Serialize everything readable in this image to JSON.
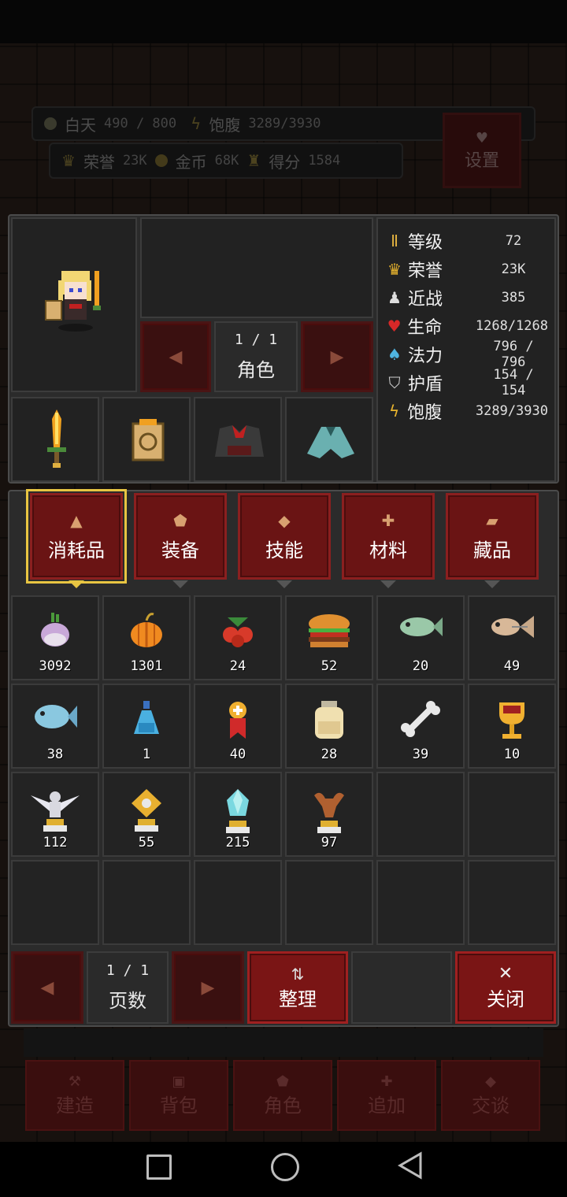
{
  "hud": {
    "day_label": "白天",
    "day_value": "490 / 800",
    "hunger_label": "饱腹",
    "hunger_value": "3289/3930",
    "honor_label": "荣誉",
    "honor_value": "23K",
    "gold_label": "金币",
    "gold_value": "68K",
    "score_label": "得分",
    "score_value": "1584",
    "settings_label": "设置"
  },
  "character": {
    "page": "1  /  1",
    "label": "角色"
  },
  "stats": [
    {
      "icon": "level-icon",
      "glyph": "Ⅱ",
      "color": "#e0b040",
      "label": "等级",
      "value": "72"
    },
    {
      "icon": "crown-icon",
      "glyph": "♛",
      "color": "#e8b42e",
      "label": "荣誉",
      "value": "23K"
    },
    {
      "icon": "melee-icon",
      "glyph": "♟",
      "color": "#dddddd",
      "label": "近战",
      "value": "385"
    },
    {
      "icon": "heart-icon",
      "glyph": "♥",
      "color": "#d82828",
      "label": "生命",
      "value": "1268/1268"
    },
    {
      "icon": "mana-potion-icon",
      "glyph": "♠",
      "color": "#4fb4e0",
      "label": "法力",
      "value": "796 / 796"
    },
    {
      "icon": "shield-icon",
      "glyph": "⛉",
      "color": "#cfcfcf",
      "label": "护盾",
      "value": "154 / 154"
    },
    {
      "icon": "hunger-icon",
      "glyph": "ϟ",
      "color": "#e8b42e",
      "label": "饱腹",
      "value": "3289/3930"
    }
  ],
  "tabs": [
    {
      "name": "tab-consumables",
      "icon": "flask-icon",
      "glyph": "▲",
      "label": "消耗品",
      "active": true
    },
    {
      "name": "tab-equipment",
      "icon": "shield-icon",
      "glyph": "⬟",
      "label": "装备",
      "active": false
    },
    {
      "name": "tab-skills",
      "icon": "diamond-icon",
      "glyph": "◆",
      "label": "技能",
      "active": false
    },
    {
      "name": "tab-materials",
      "icon": "cross-icon",
      "glyph": "✚",
      "label": "材料",
      "active": false
    },
    {
      "name": "tab-collection",
      "icon": "scroll-icon",
      "glyph": "▰",
      "label": "藏品",
      "active": false
    }
  ],
  "items": [
    {
      "icon": "turnip-icon",
      "count": "3092"
    },
    {
      "icon": "pumpkin-icon",
      "count": "1301"
    },
    {
      "icon": "berries-icon",
      "count": "24"
    },
    {
      "icon": "burger-icon",
      "count": "52"
    },
    {
      "icon": "fish-icon",
      "count": "20"
    },
    {
      "icon": "fish-bone-icon",
      "count": "49"
    },
    {
      "icon": "blue-fish-icon",
      "count": "38"
    },
    {
      "icon": "potion-icon",
      "count": "1"
    },
    {
      "icon": "medal-icon",
      "count": "40"
    },
    {
      "icon": "jar-icon",
      "count": "28"
    },
    {
      "icon": "bone-icon",
      "count": "39"
    },
    {
      "icon": "goblet-icon",
      "count": "10"
    },
    {
      "icon": "angel-statue-icon",
      "count": "112"
    },
    {
      "icon": "gold-relic-icon",
      "count": "55"
    },
    {
      "icon": "crystal-icon",
      "count": "215"
    },
    {
      "icon": "horn-relic-icon",
      "count": "97"
    }
  ],
  "pager": {
    "page": "1  /  1",
    "label": "页数",
    "sort_label": "整理",
    "close_label": "关闭"
  },
  "bottom_menu": [
    "建造",
    "背包",
    "角色",
    "追加",
    "交谈"
  ],
  "colors": {
    "accent": "#e8c542",
    "button_red": "#6a1414",
    "panel": "#2b2b2b"
  }
}
